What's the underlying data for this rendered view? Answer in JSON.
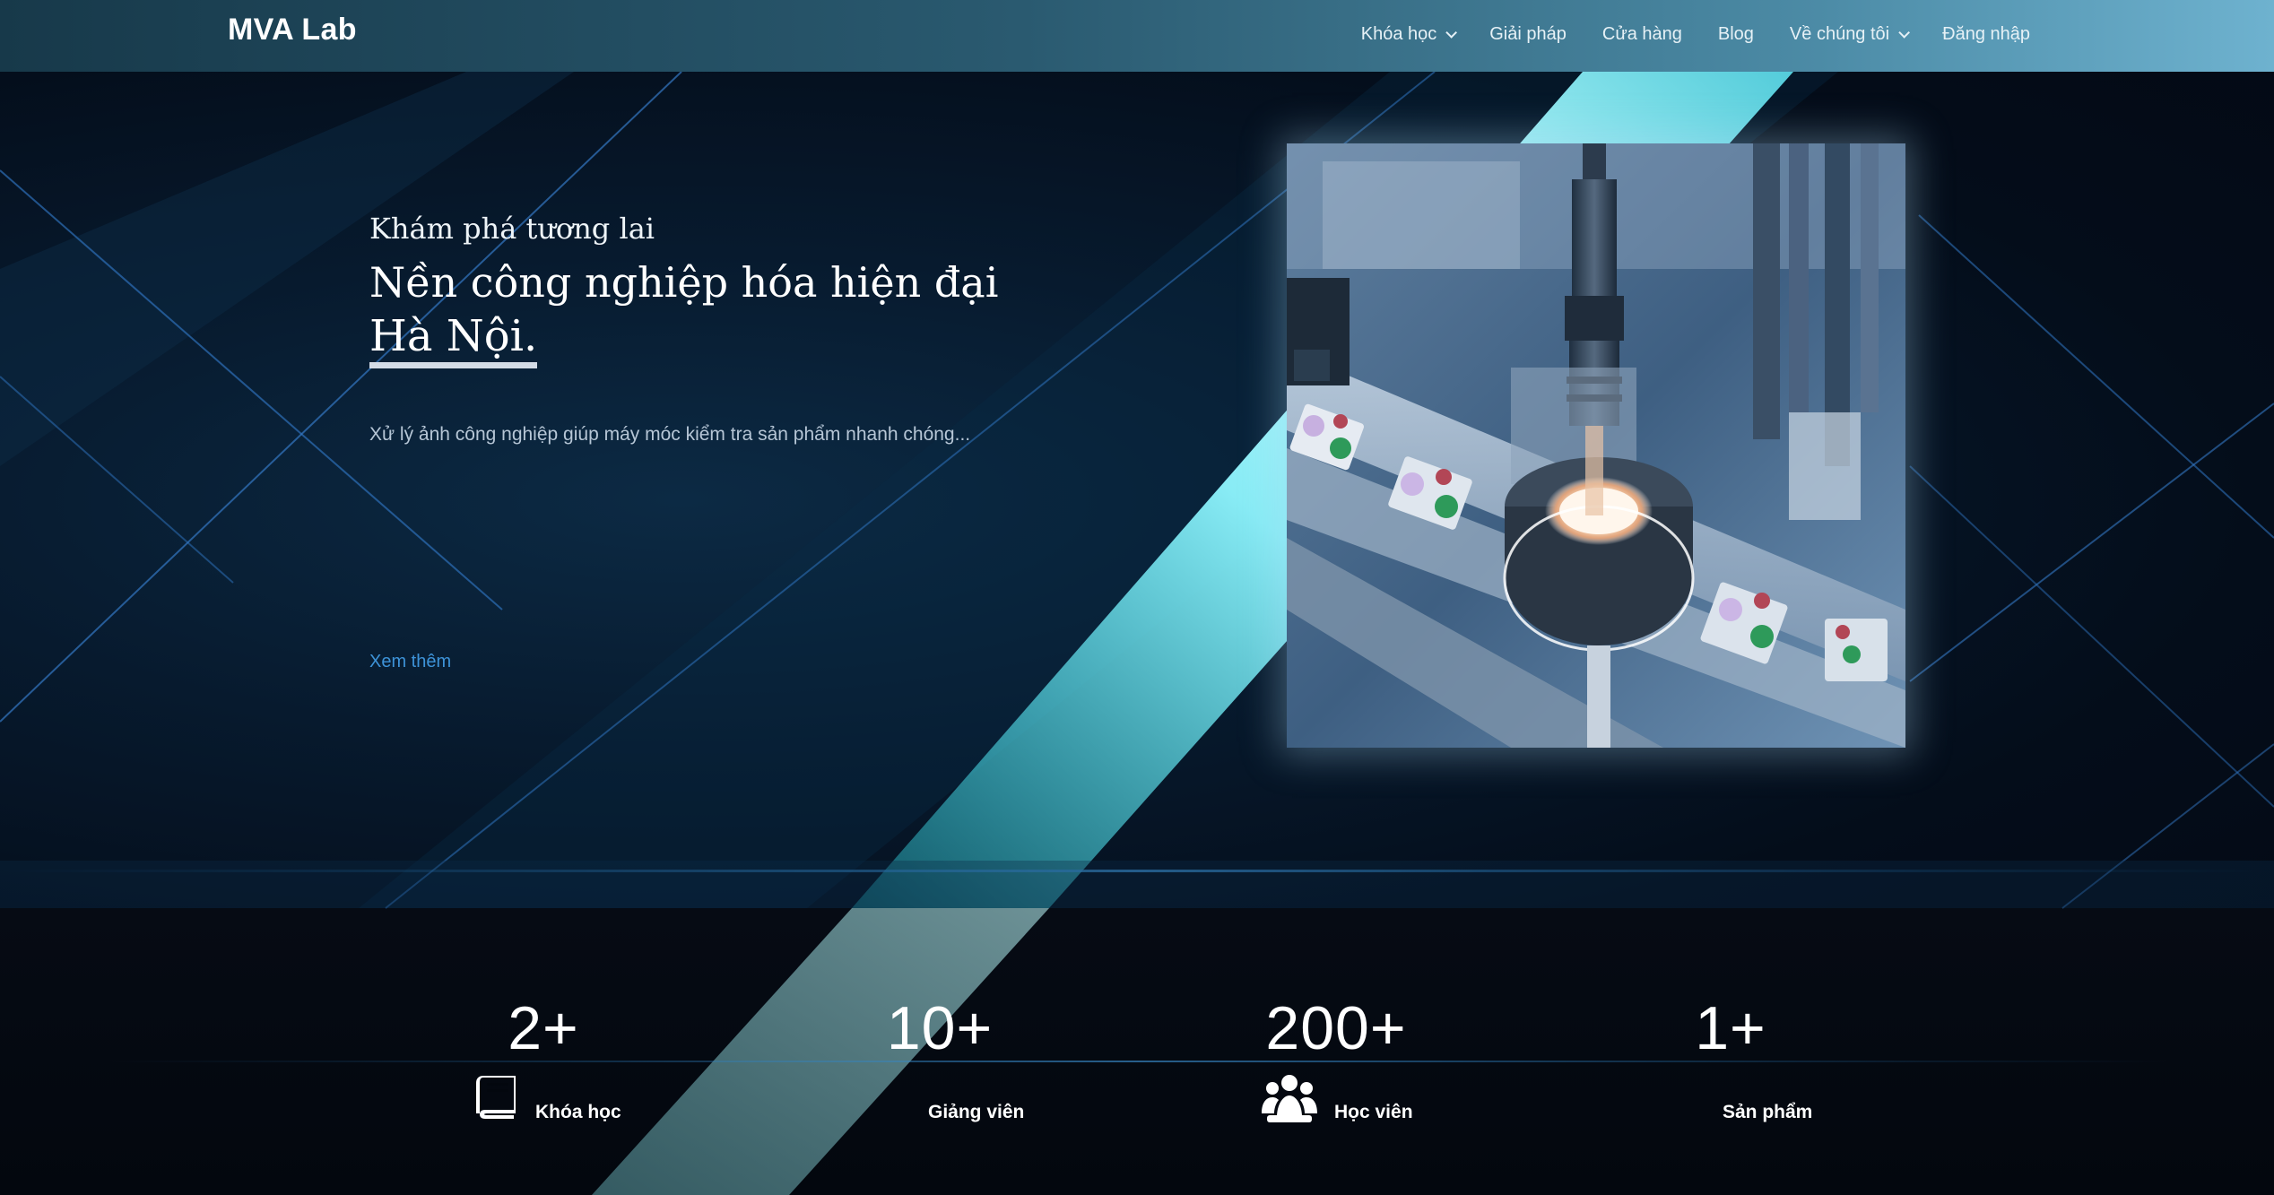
{
  "navbar": {
    "brand": "MVA Lab",
    "items": [
      {
        "label": "Khóa học",
        "has_dropdown": true
      },
      {
        "label": "Giải pháp",
        "has_dropdown": false
      },
      {
        "label": "Cửa hàng",
        "has_dropdown": false
      },
      {
        "label": "Blog",
        "has_dropdown": false
      },
      {
        "label": "Về chúng tôi",
        "has_dropdown": true
      },
      {
        "label": "Đăng nhập",
        "has_dropdown": false
      }
    ]
  },
  "hero": {
    "eyebrow": "Khám phá tương lai",
    "headline": "Nền công nghiệp hóa hiện đại",
    "highlight": "Hà Nội.",
    "description": "Xử lý ảnh công nghiệp giúp máy móc kiểm tra sản phẩm nhanh chóng...",
    "more_link": "Xem thêm",
    "image_subject": "industrial machine vision camera with ring light over conveyor"
  },
  "stats": [
    {
      "value": "2+",
      "label": "Khóa học",
      "icon": "book-icon"
    },
    {
      "value": "10+",
      "label": "Giảng viên",
      "icon": ""
    },
    {
      "value": "200+",
      "label": "Học viên",
      "icon": "users-icon"
    },
    {
      "value": "1+",
      "label": "Sản phẩm",
      "icon": ""
    }
  ],
  "colors": {
    "nav_gradient_start": "#17394a",
    "nav_gradient_end": "#6eb2cf",
    "hero_bg": "#071a2e",
    "accent_cyan": "#b8fbff",
    "link": "#3d93d8",
    "stats_bg": "#03070e"
  }
}
